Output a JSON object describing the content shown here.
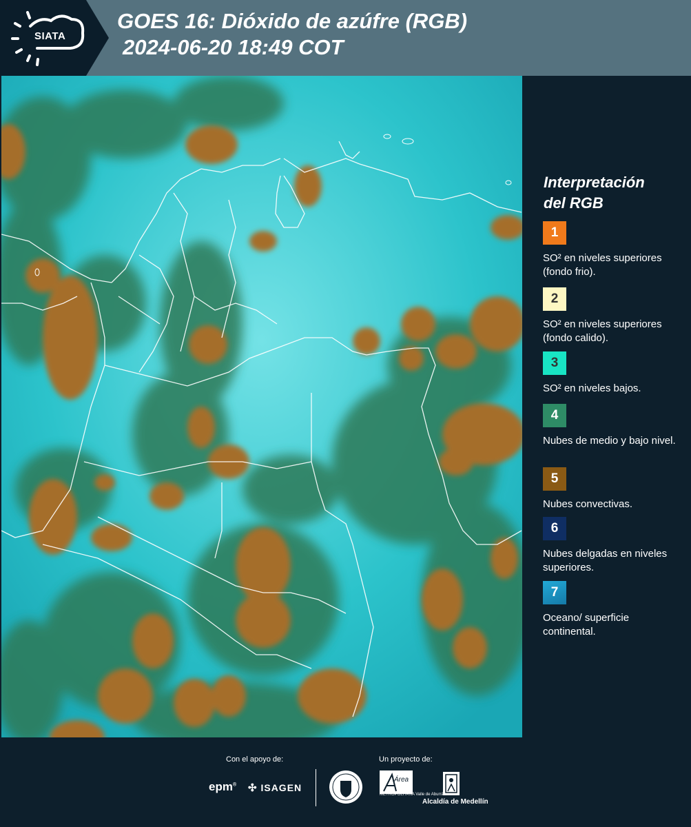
{
  "header": {
    "logo_text": "SIATA",
    "title_line1": "GOES 16: Dióxido de azúfre (RGB)",
    "title_line2": "2024-06-20 18:49 COT"
  },
  "legend": {
    "title_line1": "Interpretación",
    "title_line2": "del RGB",
    "items": [
      {
        "number": "1",
        "color": "#f07a1b",
        "label": "SO² en niveles superiores (fondo frio)."
      },
      {
        "number": "2",
        "color": "#fdf7c3",
        "label": "SO² en niveles superiores (fondo calido)."
      },
      {
        "number": "3",
        "color": "#18e4c4",
        "label": "SO² en niveles bajos."
      },
      {
        "number": "4",
        "color": "#2e8c66",
        "label": "Nubes de medio y bajo nivel."
      },
      {
        "number": "5",
        "color": "#8a5a14",
        "label": "Nubes convectivas."
      },
      {
        "number": "6",
        "color": "#0f2e63",
        "label": "Nubes delgadas en niveles superiores."
      },
      {
        "number": "7",
        "color": "#1b8fbf",
        "label": "Oceano/ superficie continental."
      }
    ]
  },
  "footer": {
    "support_label": "Con el apoyo de:",
    "project_label": "Un proyecto de:",
    "epm": "epm",
    "isagen": "ISAGEN",
    "area_text": "Área",
    "area_sub": "METROPOLITANA Valle de Aburrá",
    "alcaldia": "Alcaldía de Medellín"
  },
  "colors": {
    "header_bg": "#55727f",
    "panel_bg": "#0d1f2c",
    "map_cyan": "#2ab7c2",
    "cloud_brown": "#a56e2c",
    "cloud_green": "#2f7a58"
  }
}
